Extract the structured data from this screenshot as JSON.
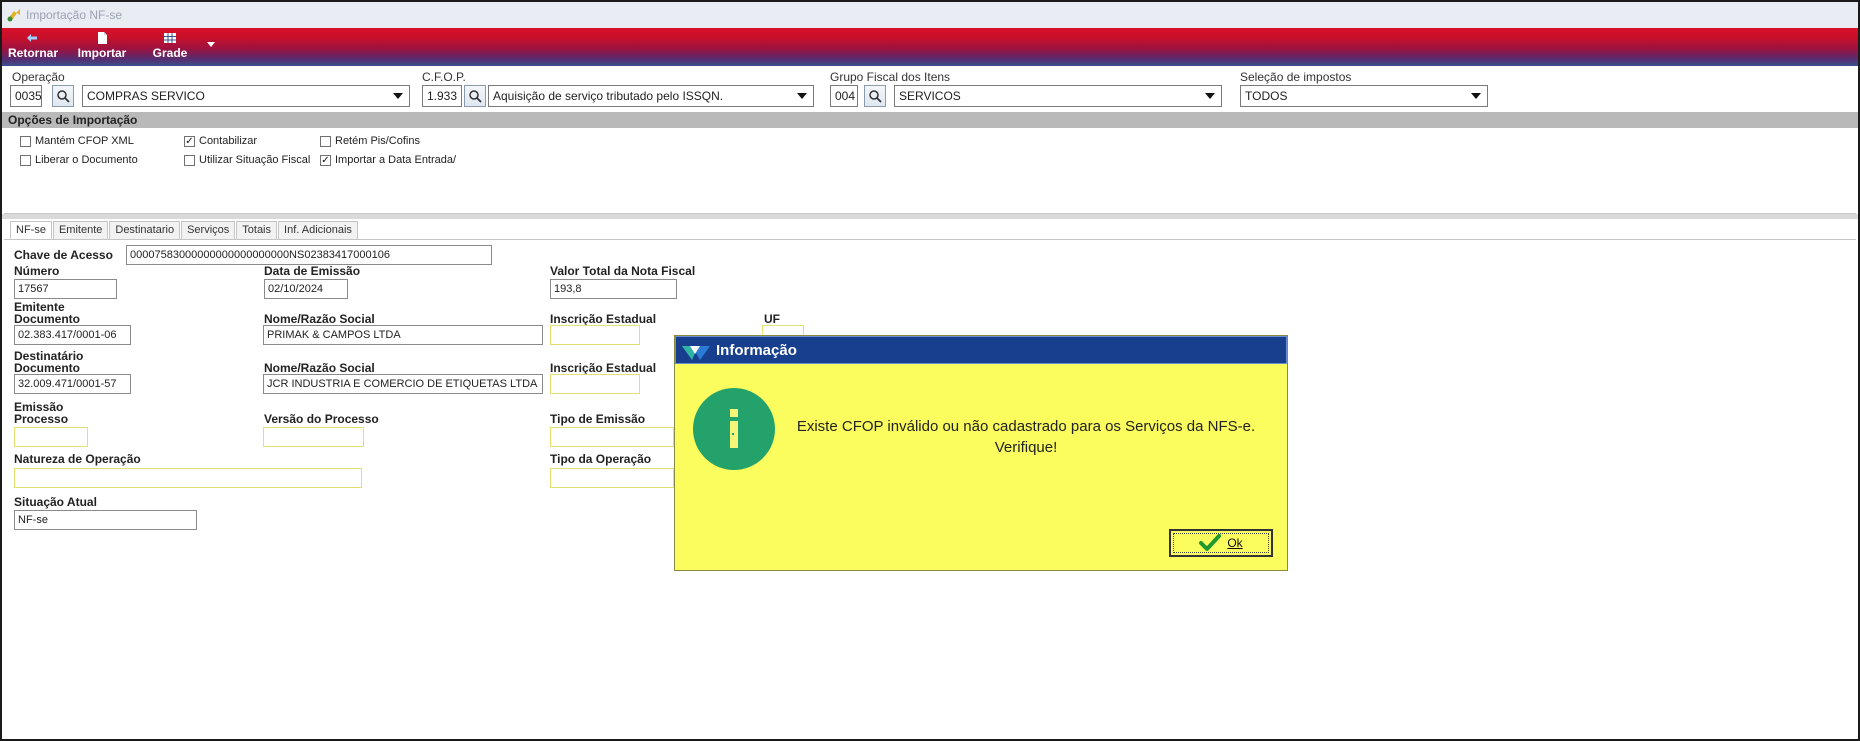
{
  "window": {
    "title": "Importação NF-se"
  },
  "toolbar": {
    "retornar": "Retornar",
    "importar": "Importar",
    "grade": "Grade"
  },
  "filters": {
    "operacao": {
      "label": "Operação",
      "code": "0035",
      "value": "COMPRAS SERVICO"
    },
    "cfop": {
      "label": "C.F.O.P.",
      "code": "1.933",
      "value": "Aquisição de serviço tributado pelo ISSQN."
    },
    "grupo": {
      "label": "Grupo Fiscal dos Itens",
      "code": "004",
      "value": "SERVICOS"
    },
    "impostos": {
      "label": "Seleção de impostos",
      "value": "TODOS"
    }
  },
  "opcoes": {
    "title": "Opções de Importação",
    "items": [
      {
        "label": "Mantém CFOP XML",
        "checked": false
      },
      {
        "label": "Liberar o Documento",
        "checked": false
      },
      {
        "label": "Contabilizar",
        "checked": true
      },
      {
        "label": "Utilizar Situação Fiscal",
        "checked": false
      },
      {
        "label": "Retém Pis/Cofins",
        "checked": false
      },
      {
        "label": "Importar a Data Entrada/",
        "checked": true
      }
    ]
  },
  "tabs": [
    "NF-se",
    "Emitente",
    "Destinatario",
    "Serviços",
    "Totais",
    "Inf. Adicionais"
  ],
  "form": {
    "chave_label": "Chave de Acesso",
    "chave_value": "00007583000000000000000000NS02383417000106",
    "numero_label": "Número",
    "numero_value": "17567",
    "data_label": "Data de Emissão",
    "data_value": "02/10/2024",
    "valor_label": "Valor Total da Nota Fiscal",
    "valor_value": "193,8",
    "emitente_label": "Emitente",
    "documento_label": "Documento",
    "emit_doc_value": "02.383.417/0001-06",
    "nome_label": "Nome/Razão Social",
    "emit_nome_value": "PRIMAK & CAMPOS LTDA",
    "ie_label": "Inscrição Estadual",
    "uf_label": "UF",
    "destinatario_label": "Destinatário",
    "dest_doc_value": "32.009.471/0001-57",
    "dest_nome_value": "JCR INDUSTRIA E COMERCIO DE ETIQUETAS LTDA",
    "emissao_label": "Emissão",
    "processo_label": "Processo",
    "versao_label": "Versão do Processo",
    "tipo_emissao_label": "Tipo de Emissão",
    "natureza_label": "Natureza de Operação",
    "tipo_operacao_label": "Tipo da Operação",
    "situacao_label": "Situação Atual",
    "situacao_value": "NF-se"
  },
  "dialog": {
    "title": "Informação",
    "message_line1": "Existe CFOP inválido ou não cadastrado para os Serviços da NFS-e.",
    "message_line2": "Verifique!",
    "ok_label": "Ok",
    "colors": {
      "background": "#fbfc5e",
      "titlebar": "#173f8e",
      "info": "#23a36b"
    }
  }
}
